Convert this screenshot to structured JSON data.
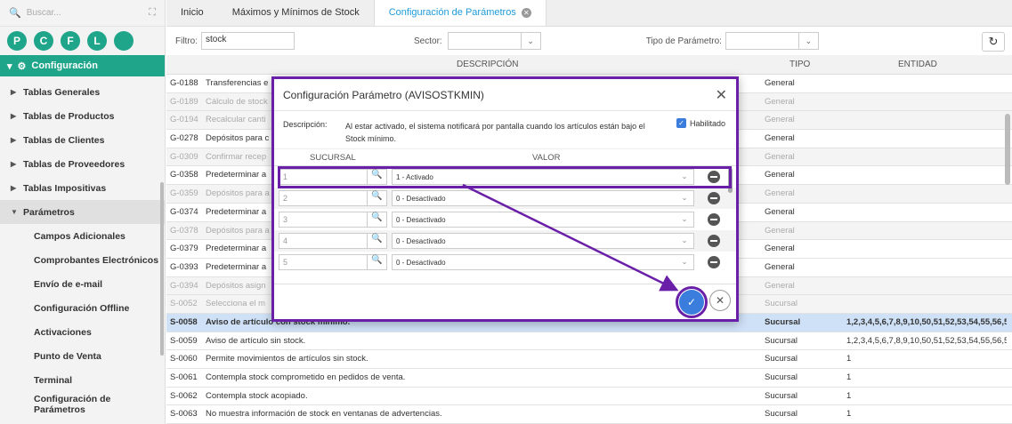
{
  "sidebar": {
    "search_placeholder": "Buscar...",
    "circles": [
      "P",
      "C",
      "F",
      "L",
      ""
    ],
    "section": "Configuración",
    "items": [
      {
        "label": "Tablas Generales"
      },
      {
        "label": "Tablas de Productos"
      },
      {
        "label": "Tablas de Clientes"
      },
      {
        "label": "Tablas de Proveedores"
      },
      {
        "label": "Tablas Impositivas"
      },
      {
        "label": "Parámetros"
      }
    ],
    "sub_items": [
      {
        "label": "Campos Adicionales"
      },
      {
        "label": "Comprobantes Electrónicos"
      },
      {
        "label": "Envío de e-mail"
      },
      {
        "label": "Configuración Offline"
      },
      {
        "label": "Activaciones"
      },
      {
        "label": "Punto de Venta"
      },
      {
        "label": "Terminal"
      },
      {
        "label": "Configuración de Parámetros"
      }
    ]
  },
  "tabs": [
    {
      "label": "Inicio"
    },
    {
      "label": "Máximos y Mínimos de Stock"
    },
    {
      "label": "Configuración de Parámetros"
    }
  ],
  "filters": {
    "filtro_label": "Filtro:",
    "filtro_value": "stock",
    "sector_label": "Sector:",
    "tipo_label": "Tipo de Parámetro:"
  },
  "table": {
    "headers": {
      "descripcion": "DESCRIPCIÓN",
      "tipo": "TIPO",
      "entidad": "ENTIDAD"
    },
    "rows": [
      {
        "code": "G-0188",
        "desc": "Transferencias e",
        "tipo": "General",
        "entidad": "",
        "style": "norm"
      },
      {
        "code": "G-0189",
        "desc": "Cálculo de stock",
        "tipo": "General",
        "entidad": "",
        "style": "alt"
      },
      {
        "code": "G-0194",
        "desc": "Recalcular canti",
        "tipo": "General",
        "entidad": "",
        "style": "alt"
      },
      {
        "code": "G-0278",
        "desc": "Depósitos para c",
        "tipo": "General",
        "entidad": "",
        "style": "norm"
      },
      {
        "code": "G-0309",
        "desc": "Confirmar recep",
        "tipo": "General",
        "entidad": "",
        "style": "alt"
      },
      {
        "code": "G-0358",
        "desc": "Predeterminar a",
        "tipo": "General",
        "entidad": "",
        "style": "norm"
      },
      {
        "code": "G-0359",
        "desc": "Depósitos para a",
        "tipo": "General",
        "entidad": "",
        "style": "alt"
      },
      {
        "code": "G-0374",
        "desc": "Predeterminar a",
        "tipo": "General",
        "entidad": "",
        "style": "norm"
      },
      {
        "code": "G-0378",
        "desc": "Depósitos para a",
        "tipo": "General",
        "entidad": "",
        "style": "alt"
      },
      {
        "code": "G-0379",
        "desc": "Predeterminar a",
        "tipo": "General",
        "entidad": "",
        "style": "norm"
      },
      {
        "code": "G-0393",
        "desc": "Predeterminar a",
        "tipo": "General",
        "entidad": "",
        "style": "norm"
      },
      {
        "code": "G-0394",
        "desc": "Depósitos asign",
        "tipo": "General",
        "entidad": "",
        "style": "alt"
      },
      {
        "code": "S-0052",
        "desc": "Selecciona el m",
        "tipo": "Sucursal",
        "entidad": "",
        "style": "alt"
      },
      {
        "code": "S-0058",
        "desc": "Aviso de artículo con stock mínimo.",
        "tipo": "Sucursal",
        "entidad": "1,2,3,4,5,6,7,8,9,10,50,51,52,53,54,55,56,5",
        "style": "sel-row"
      },
      {
        "code": "S-0059",
        "desc": "Aviso de artículo sin stock.",
        "tipo": "Sucursal",
        "entidad": "1,2,3,4,5,6,7,8,9,10,50,51,52,53,54,55,56,5",
        "style": "norm"
      },
      {
        "code": "S-0060",
        "desc": "Permite movimientos de artículos sin stock.",
        "tipo": "Sucursal",
        "entidad": "1",
        "style": "norm"
      },
      {
        "code": "S-0061",
        "desc": "Contempla stock comprometido en pedidos de venta.",
        "tipo": "Sucursal",
        "entidad": "1",
        "style": "norm"
      },
      {
        "code": "S-0062",
        "desc": "Contempla stock acopiado.",
        "tipo": "Sucursal",
        "entidad": "1",
        "style": "norm"
      },
      {
        "code": "S-0063",
        "desc": "No muestra información de stock en ventanas de advertencias.",
        "tipo": "Sucursal",
        "entidad": "1",
        "style": "norm"
      }
    ]
  },
  "modal": {
    "title": "Configuración Parámetro (AVISOSTKMIN)",
    "desc_label": "Descripción:",
    "desc_text": "Al estar activado, el sistema notificará por pantalla cuando los artículos están bajo el Stock mínimo.",
    "habilitado_label": "Habilitado",
    "col_sucursal": "SUCURSAL",
    "col_valor": "VALOR",
    "rows": [
      {
        "sucursal": "1",
        "valor": "1 - Activado"
      },
      {
        "sucursal": "2",
        "valor": "0 - Desactivado"
      },
      {
        "sucursal": "3",
        "valor": "0 - Desactivado"
      },
      {
        "sucursal": "4",
        "valor": "0 - Desactivado"
      },
      {
        "sucursal": "5",
        "valor": "0 - Desactivado"
      }
    ]
  }
}
